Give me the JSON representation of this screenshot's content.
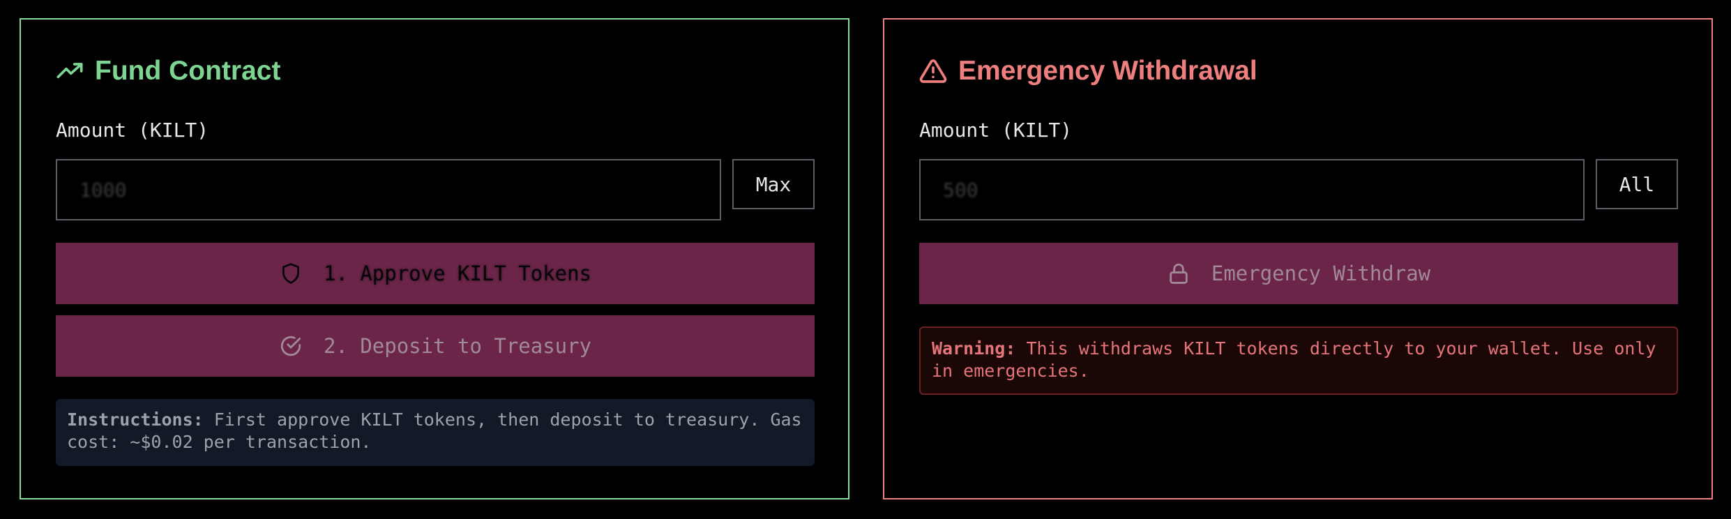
{
  "fund": {
    "title": "Fund Contract",
    "title_icon": "trending-up-icon",
    "amount_label": "Amount (KILT)",
    "amount_placeholder": "1000",
    "max_label": "Max",
    "approve_label": "1. Approve KILT Tokens",
    "approve_icon": "shield-icon",
    "deposit_label": "2. Deposit to Treasury",
    "deposit_icon": "check-circle-icon",
    "instructions_label": "Instructions:",
    "instructions_text": " First approve KILT tokens, then deposit to treasury. Gas cost: ~$0.02 per transaction."
  },
  "emergency": {
    "title": "Emergency Withdrawal",
    "title_icon": "warning-triangle-icon",
    "amount_label": "Amount (KILT)",
    "amount_placeholder": "500",
    "all_label": "All",
    "withdraw_label": "Emergency Withdraw",
    "withdraw_icon": "lock-icon",
    "warning_label": "Warning:",
    "warning_text": " This withdraws KILT tokens directly to your wallet. Use only in emergencies."
  },
  "colors": {
    "fund_accent": "#7ed492",
    "emergency_accent": "#ef7f7f",
    "button_bg": "#6a2548",
    "instructions_bg": "#121a28",
    "warning_bg": "#1c0707"
  }
}
